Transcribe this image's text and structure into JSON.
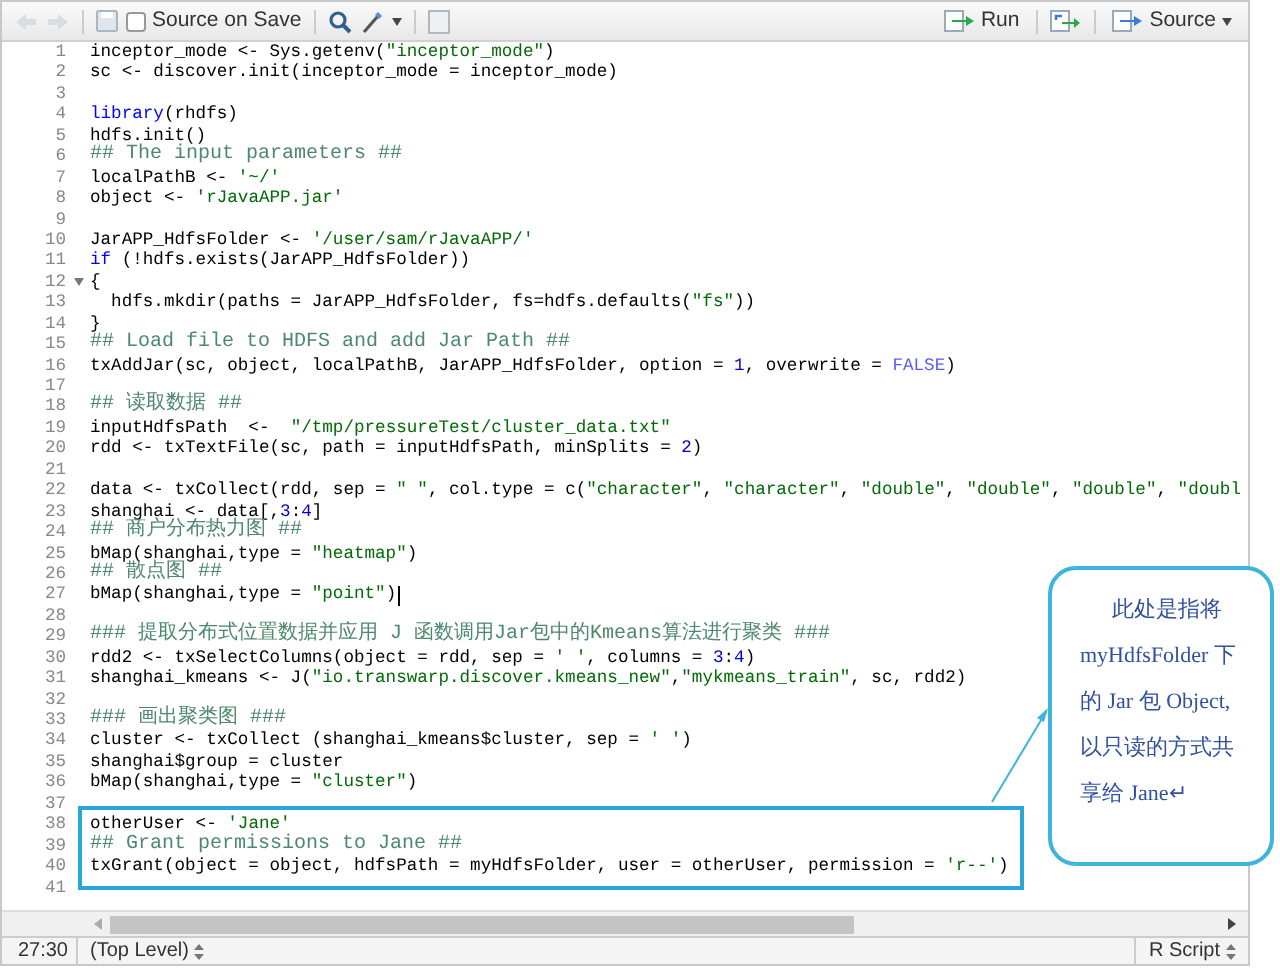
{
  "toolbar": {
    "source_on_save": {
      "label": "Source on Save",
      "checked": false
    },
    "run_button": "Run",
    "source_button": "Source"
  },
  "lines": [
    {
      "number": "1",
      "fold": false,
      "cursor": false,
      "boxed": false,
      "segments": [
        {
          "kind": "plain",
          "text": "inceptor_mode <- Sys.getenv("
        },
        {
          "kind": "string",
          "text": "\"inceptor_mode\""
        },
        {
          "kind": "plain",
          "text": ")"
        }
      ]
    },
    {
      "number": "2",
      "fold": false,
      "cursor": false,
      "boxed": false,
      "segments": [
        {
          "kind": "plain",
          "text": "sc <- discover.init(inceptor_mode = inceptor_mode)"
        }
      ]
    },
    {
      "number": "3",
      "fold": false,
      "cursor": false,
      "boxed": false
    },
    {
      "number": "4",
      "fold": false,
      "cursor": false,
      "boxed": false,
      "segments": [
        {
          "kind": "keyword",
          "text": "library"
        },
        {
          "kind": "plain",
          "text": "(rhdfs)"
        }
      ]
    },
    {
      "number": "5",
      "fold": false,
      "cursor": false,
      "boxed": false,
      "segments": [
        {
          "kind": "plain",
          "text": "hdfs.init()"
        }
      ]
    },
    {
      "number": "6",
      "fold": false,
      "cursor": false,
      "boxed": false,
      "segments": [
        {
          "kind": "comment",
          "text": "## The input parameters ##"
        }
      ]
    },
    {
      "number": "7",
      "fold": false,
      "cursor": false,
      "boxed": false,
      "segments": [
        {
          "kind": "plain",
          "text": "localPathB <- "
        },
        {
          "kind": "string",
          "text": "'~/'"
        }
      ]
    },
    {
      "number": "8",
      "fold": false,
      "cursor": false,
      "boxed": false,
      "segments": [
        {
          "kind": "plain",
          "text": "object <- "
        },
        {
          "kind": "string",
          "text": "'rJavaAPP.jar'"
        }
      ]
    },
    {
      "number": "9",
      "fold": false,
      "cursor": false,
      "boxed": false
    },
    {
      "number": "10",
      "fold": false,
      "cursor": false,
      "boxed": false,
      "segments": [
        {
          "kind": "plain",
          "text": "JarAPP_HdfsFolder <- "
        },
        {
          "kind": "string",
          "text": "'/user/sam/rJavaAPP/'"
        }
      ]
    },
    {
      "number": "11",
      "fold": false,
      "cursor": false,
      "boxed": false,
      "segments": [
        {
          "kind": "keyword",
          "text": "if"
        },
        {
          "kind": "plain",
          "text": " (!hdfs.exists(JarAPP_HdfsFolder))"
        }
      ]
    },
    {
      "number": "12",
      "fold": true,
      "cursor": false,
      "boxed": false,
      "segments": [
        {
          "kind": "plain",
          "text": "{"
        }
      ]
    },
    {
      "number": "13",
      "fold": false,
      "cursor": false,
      "boxed": false,
      "segments": [
        {
          "kind": "plain",
          "text": "  hdfs.mkdir(paths = JarAPP_HdfsFolder, fs=hdfs.defaults("
        },
        {
          "kind": "string",
          "text": "\"fs\""
        },
        {
          "kind": "plain",
          "text": "))"
        }
      ]
    },
    {
      "number": "14",
      "fold": false,
      "cursor": false,
      "boxed": false,
      "segments": [
        {
          "kind": "plain",
          "text": "}"
        }
      ]
    },
    {
      "number": "15",
      "fold": false,
      "cursor": false,
      "boxed": false,
      "segments": [
        {
          "kind": "comment",
          "text": "## Load file to HDFS and add Jar Path ##"
        }
      ]
    },
    {
      "number": "16",
      "fold": false,
      "cursor": false,
      "boxed": false,
      "segments": [
        {
          "kind": "plain",
          "text": "txAddJar(sc, object, localPathB, JarAPP_HdfsFolder, option = "
        },
        {
          "kind": "number",
          "text": "1"
        },
        {
          "kind": "plain",
          "text": ", overwrite = "
        },
        {
          "kind": "constant",
          "text": "FALSE"
        },
        {
          "kind": "plain",
          "text": ")"
        }
      ]
    },
    {
      "number": "17",
      "fold": false,
      "cursor": false,
      "boxed": false
    },
    {
      "number": "18",
      "fold": false,
      "cursor": false,
      "boxed": false,
      "segments": [
        {
          "kind": "comment",
          "text": "## 读取数据 ##"
        }
      ]
    },
    {
      "number": "19",
      "fold": false,
      "cursor": false,
      "boxed": false,
      "segments": [
        {
          "kind": "plain",
          "text": "inputHdfsPath  <-  "
        },
        {
          "kind": "string",
          "text": "\"/tmp/pressureTest/cluster_data.txt\""
        }
      ]
    },
    {
      "number": "20",
      "fold": false,
      "cursor": false,
      "boxed": false,
      "segments": [
        {
          "kind": "plain",
          "text": "rdd <- txTextFile(sc, path = inputHdfsPath, minSplits = "
        },
        {
          "kind": "number",
          "text": "2"
        },
        {
          "kind": "plain",
          "text": ")"
        }
      ]
    },
    {
      "number": "21",
      "fold": false,
      "cursor": false,
      "boxed": false
    },
    {
      "number": "22",
      "fold": false,
      "cursor": false,
      "boxed": false,
      "segments": [
        {
          "kind": "plain",
          "text": "data <- txCollect(rdd, sep = "
        },
        {
          "kind": "string",
          "text": "\" \""
        },
        {
          "kind": "plain",
          "text": ", col.type = c("
        },
        {
          "kind": "string",
          "text": "\"character\""
        },
        {
          "kind": "plain",
          "text": ", "
        },
        {
          "kind": "string",
          "text": "\"character\""
        },
        {
          "kind": "plain",
          "text": ", "
        },
        {
          "kind": "string",
          "text": "\"double\""
        },
        {
          "kind": "plain",
          "text": ", "
        },
        {
          "kind": "string",
          "text": "\"double\""
        },
        {
          "kind": "plain",
          "text": ", "
        },
        {
          "kind": "string",
          "text": "\"double\""
        },
        {
          "kind": "plain",
          "text": ", "
        },
        {
          "kind": "string",
          "text": "\"doubl"
        }
      ]
    },
    {
      "number": "23",
      "fold": false,
      "cursor": false,
      "boxed": false,
      "segments": [
        {
          "kind": "plain",
          "text": "shanghai <- data[,"
        },
        {
          "kind": "number",
          "text": "3"
        },
        {
          "kind": "plain",
          "text": ":"
        },
        {
          "kind": "number",
          "text": "4"
        },
        {
          "kind": "plain",
          "text": "]"
        }
      ]
    },
    {
      "number": "24",
      "fold": false,
      "cursor": false,
      "boxed": false,
      "segments": [
        {
          "kind": "comment",
          "text": "## 商户分布热力图 ##"
        }
      ]
    },
    {
      "number": "25",
      "fold": false,
      "cursor": false,
      "boxed": false,
      "segments": [
        {
          "kind": "plain",
          "text": "bMap(shanghai,type = "
        },
        {
          "kind": "string",
          "text": "\"heatmap\""
        },
        {
          "kind": "plain",
          "text": ")"
        }
      ]
    },
    {
      "number": "26",
      "fold": false,
      "cursor": false,
      "boxed": false,
      "segments": [
        {
          "kind": "comment",
          "text": "## 散点图 ##"
        }
      ]
    },
    {
      "number": "27",
      "fold": false,
      "cursor": true,
      "boxed": false,
      "segments": [
        {
          "kind": "plain",
          "text": "bMap(shanghai,type = "
        },
        {
          "kind": "string",
          "text": "\"point\""
        },
        {
          "kind": "plain",
          "text": ")"
        }
      ]
    },
    {
      "number": "28",
      "fold": false,
      "cursor": false,
      "boxed": false
    },
    {
      "number": "29",
      "fold": false,
      "cursor": false,
      "boxed": false,
      "segments": [
        {
          "kind": "comment",
          "text": "### 提取分布式位置数据并应用 J 函数调用Jar包中的Kmeans算法进行聚类 ###"
        }
      ]
    },
    {
      "number": "30",
      "fold": false,
      "cursor": false,
      "boxed": false,
      "segments": [
        {
          "kind": "plain",
          "text": "rdd2 <- txSelectColumns(object = rdd, sep = "
        },
        {
          "kind": "string",
          "text": "' '"
        },
        {
          "kind": "plain",
          "text": ", columns = "
        },
        {
          "kind": "number",
          "text": "3"
        },
        {
          "kind": "plain",
          "text": ":"
        },
        {
          "kind": "number",
          "text": "4"
        },
        {
          "kind": "plain",
          "text": ")"
        }
      ]
    },
    {
      "number": "31",
      "fold": false,
      "cursor": false,
      "boxed": false,
      "segments": [
        {
          "kind": "plain",
          "text": "shanghai_kmeans <- J("
        },
        {
          "kind": "string",
          "text": "\"io.transwarp.discover.kmeans_new\""
        },
        {
          "kind": "plain",
          "text": ","
        },
        {
          "kind": "string",
          "text": "\"mykmeans_train\""
        },
        {
          "kind": "plain",
          "text": ", sc, rdd2)"
        }
      ]
    },
    {
      "number": "32",
      "fold": false,
      "cursor": false,
      "boxed": false
    },
    {
      "number": "33",
      "fold": false,
      "cursor": false,
      "boxed": false,
      "segments": [
        {
          "kind": "comment",
          "text": "### 画出聚类图 ###"
        }
      ]
    },
    {
      "number": "34",
      "fold": false,
      "cursor": false,
      "boxed": false,
      "segments": [
        {
          "kind": "plain",
          "text": "cluster <- txCollect (shanghai_kmeans$cluster, sep = "
        },
        {
          "kind": "string",
          "text": "' '"
        },
        {
          "kind": "plain",
          "text": ")"
        }
      ]
    },
    {
      "number": "35",
      "fold": false,
      "cursor": false,
      "boxed": false,
      "segments": [
        {
          "kind": "plain",
          "text": "shanghai$group = cluster"
        }
      ]
    },
    {
      "number": "36",
      "fold": false,
      "cursor": false,
      "boxed": false,
      "segments": [
        {
          "kind": "plain",
          "text": "bMap(shanghai,type = "
        },
        {
          "kind": "string",
          "text": "\"cluster\""
        },
        {
          "kind": "plain",
          "text": ")"
        }
      ]
    },
    {
      "number": "37",
      "fold": false,
      "cursor": false,
      "boxed": false
    },
    {
      "number": "38",
      "fold": false,
      "cursor": false,
      "boxed": true,
      "segments": [
        {
          "kind": "plain",
          "text": "otherUser <- "
        },
        {
          "kind": "string",
          "text": "'Jane'"
        }
      ]
    },
    {
      "number": "39",
      "fold": false,
      "cursor": false,
      "boxed": true,
      "segments": [
        {
          "kind": "comment",
          "text": "## Grant permissions to Jane ##"
        }
      ]
    },
    {
      "number": "40",
      "fold": false,
      "cursor": false,
      "boxed": true,
      "segments": [
        {
          "kind": "plain",
          "text": "txGrant(object = object, hdfsPath = myHdfsFolder, user = otherUser, permission = "
        },
        {
          "kind": "string",
          "text": "'r--'"
        },
        {
          "kind": "plain",
          "text": ")"
        }
      ]
    },
    {
      "number": "41",
      "fold": false,
      "cursor": false,
      "boxed": false
    }
  ],
  "status_bar": {
    "position": "27:30",
    "scope": "(Top Level)",
    "file_type": "R Script"
  },
  "callout": {
    "lines": [
      "此处是指将",
      "myHdfsFolder 下",
      "的 Jar 包 Object,",
      "以只读的方式共",
      "享给 Jane↵"
    ]
  }
}
